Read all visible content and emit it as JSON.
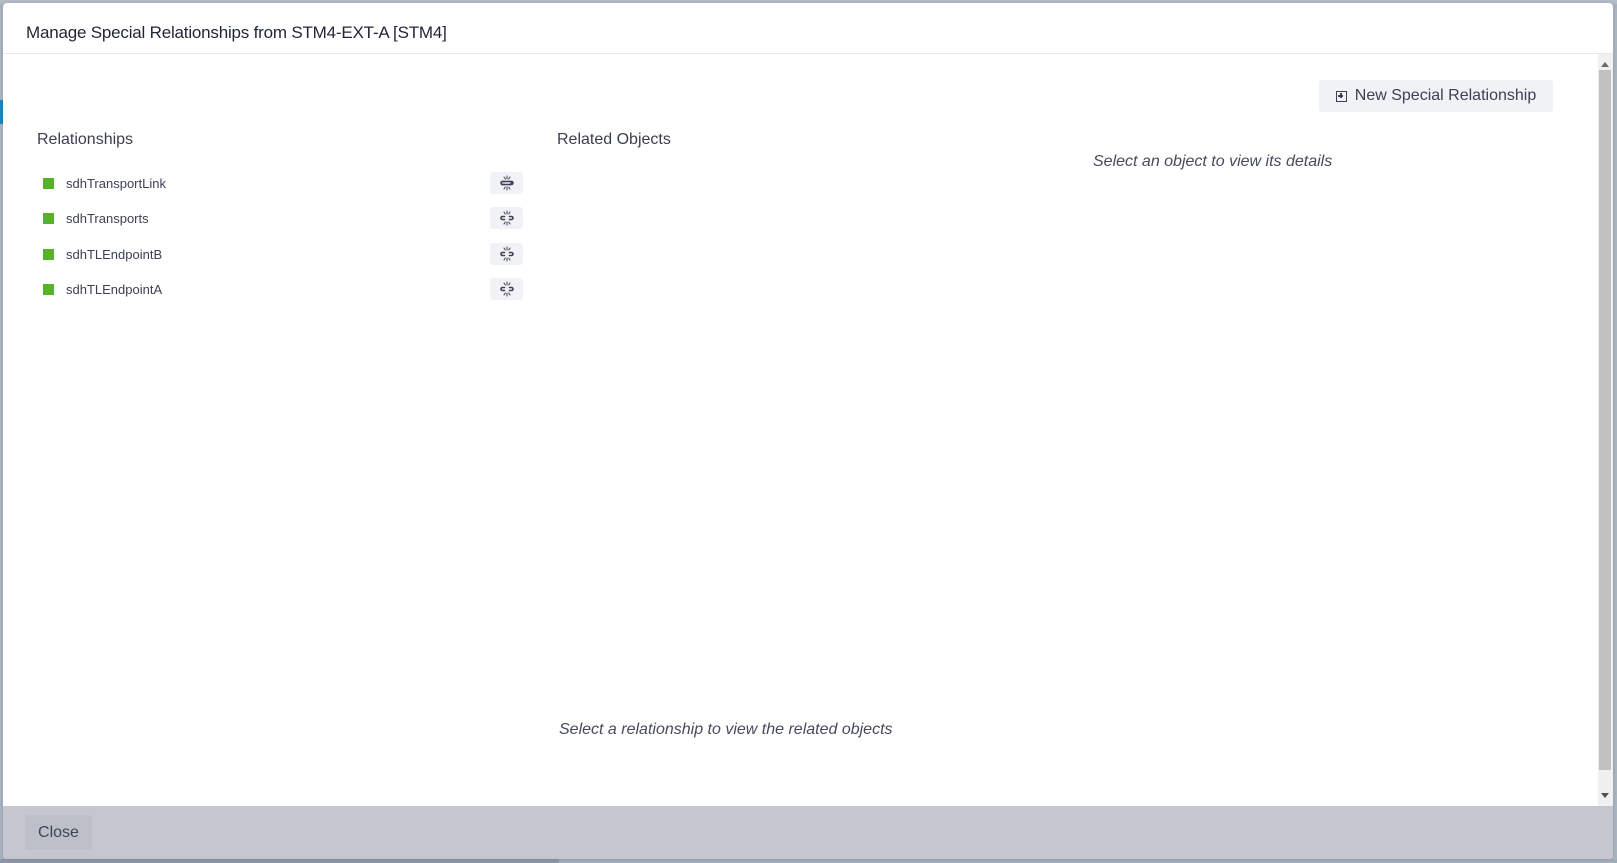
{
  "dialog": {
    "title": "Manage Special Relationships from STM4-EXT-A [STM4]"
  },
  "toolbar": {
    "new_relationship_label": "New Special Relationship",
    "new_relationship_icon": "plus-square-icon"
  },
  "relationships": {
    "heading": "Relationships",
    "indicator_color": "#55b22a",
    "action_icon": "unlink-icon",
    "items": [
      {
        "label": "sdhTransportLink"
      },
      {
        "label": "sdhTransports"
      },
      {
        "label": "sdhTLEndpointB"
      },
      {
        "label": "sdhTLEndpointA"
      }
    ]
  },
  "related_objects": {
    "heading": "Related Objects",
    "empty_hint": "Select a relationship to view the related objects"
  },
  "details": {
    "empty_hint": "Select an object to view its details"
  },
  "footer": {
    "close_label": "Close"
  }
}
